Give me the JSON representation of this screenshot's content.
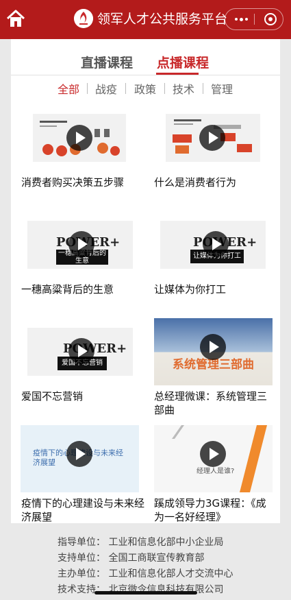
{
  "header": {
    "title": "领军人才公共服务平台",
    "accent": "#b31b1b"
  },
  "tabs": [
    {
      "label": "直播课程",
      "active": false
    },
    {
      "label": "点播课程",
      "active": true
    }
  ],
  "categories": [
    {
      "label": "全部",
      "active": true
    },
    {
      "label": "战疫",
      "active": false
    },
    {
      "label": "政策",
      "active": false
    },
    {
      "label": "技术",
      "active": false
    },
    {
      "label": "管理",
      "active": false
    }
  ],
  "courses": [
    {
      "title": "消费者购买决策五步骤",
      "thumb_icon": "diagram-thumbnail"
    },
    {
      "title": "什么是消费者行为",
      "thumb_icon": "diagram-thumbnail"
    },
    {
      "title": "一穗高粱背后的生意",
      "thumb_caption": "一穗高粱背后的生意",
      "thumb_brand": "POWER+"
    },
    {
      "title": "让媒体为你打工",
      "thumb_caption": "让媒体为你打工",
      "thumb_brand": "POWER+"
    },
    {
      "title": "爱国不忘营销",
      "thumb_caption": "爱国不忘营销",
      "thumb_brand": "POWER+"
    },
    {
      "title": "总经理微课：系统管理三部曲",
      "thumb_caption": "系统管理三部曲"
    },
    {
      "title": "疫情下的心理建设与未来经济展望",
      "thumb_caption": "疫情下的心理建设与未来经济展望"
    },
    {
      "title": "蹊成领导力3G课程：《成为一名好经理》",
      "thumb_caption": "经理人是谁?"
    }
  ],
  "footer": [
    "指导单位：  工业和信息化部中小企业局",
    "支持单位：  全国工商联宣传教育部",
    "主办单位：  工业和信息化部人才交流中心",
    "技术支持：  北京微令信息科技有限公司"
  ]
}
